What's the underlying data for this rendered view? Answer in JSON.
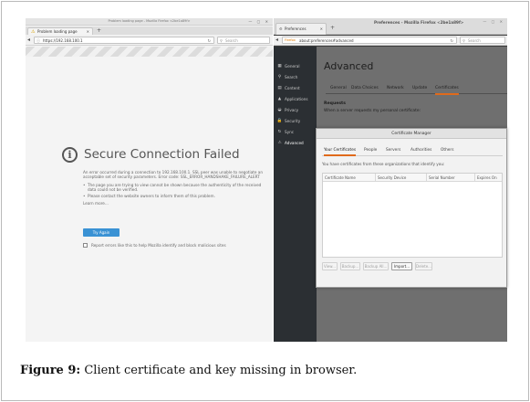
{
  "left_window": {
    "title": "Problem loading page - Mozilla Firefox <2be1a89f>",
    "tab_label": "Problem loading page",
    "tab_close": "✕",
    "new_tab": "+",
    "url": "https://192.168.100.1",
    "search_placeholder": "Search",
    "error": {
      "title": "Secure Connection Failed",
      "description": "An error occurred during a connection to 192.168.100.1. SSL peer was unable to negotiate an acceptable set of security parameters. Error code: SSL_ERROR_HANDSHAKE_FAILURE_ALERT",
      "bullets": [
        "The page you are trying to view cannot be shown because the authenticity of the received data could not be verified.",
        "Please contact the website owners to inform them of this problem."
      ],
      "learn_more": "Learn more...",
      "try_again": "Try Again",
      "report_label": "Report errors like this to help Mozilla identify and block malicious sites"
    }
  },
  "right_window": {
    "tab_label": "Preferences",
    "tab_close": "✕",
    "new_tab": "+",
    "title": "Preferences - Mozilla Firefox <2be1a89f>",
    "url_brand": "Firefox",
    "url": "about:preferences#advanced",
    "search_placeholder": "Search",
    "sidebar": [
      {
        "icon": "general-icon",
        "glyph": "▦",
        "label": "General"
      },
      {
        "icon": "search-icon",
        "glyph": "⚲",
        "label": "Search"
      },
      {
        "icon": "content-icon",
        "glyph": "▤",
        "label": "Content"
      },
      {
        "icon": "applications-icon",
        "glyph": "▲",
        "label": "Applications"
      },
      {
        "icon": "privacy-icon",
        "glyph": "◒",
        "label": "Privacy"
      },
      {
        "icon": "security-icon",
        "glyph": "🔒",
        "label": "Security"
      },
      {
        "icon": "sync-icon",
        "glyph": "↻",
        "label": "Sync"
      },
      {
        "icon": "advanced-icon",
        "glyph": "⚠",
        "label": "Advanced"
      }
    ],
    "page_title": "Advanced",
    "tabs": [
      "General",
      "Data Choices",
      "Network",
      "Update",
      "Certificates"
    ],
    "active_tab": "Certificates",
    "requests_title": "Requests",
    "requests_desc": "When a server requests my personal certificate:"
  },
  "certificate_manager": {
    "title": "Certificate Manager",
    "tabs": [
      "Your Certificates",
      "People",
      "Servers",
      "Authorities",
      "Others"
    ],
    "active_tab": "Your Certificates",
    "description": "You have certificates from these organizations that identify you:",
    "columns": [
      "Certificate Name",
      "Security Device",
      "Serial Number",
      "Expires On"
    ],
    "buttons": [
      "View...",
      "Backup...",
      "Backup All...",
      "Import...",
      "Delete..."
    ],
    "enabled_button": "Import..."
  },
  "caption": {
    "label": "Figure 9:",
    "text": "Client certificate and key missing in browser."
  }
}
